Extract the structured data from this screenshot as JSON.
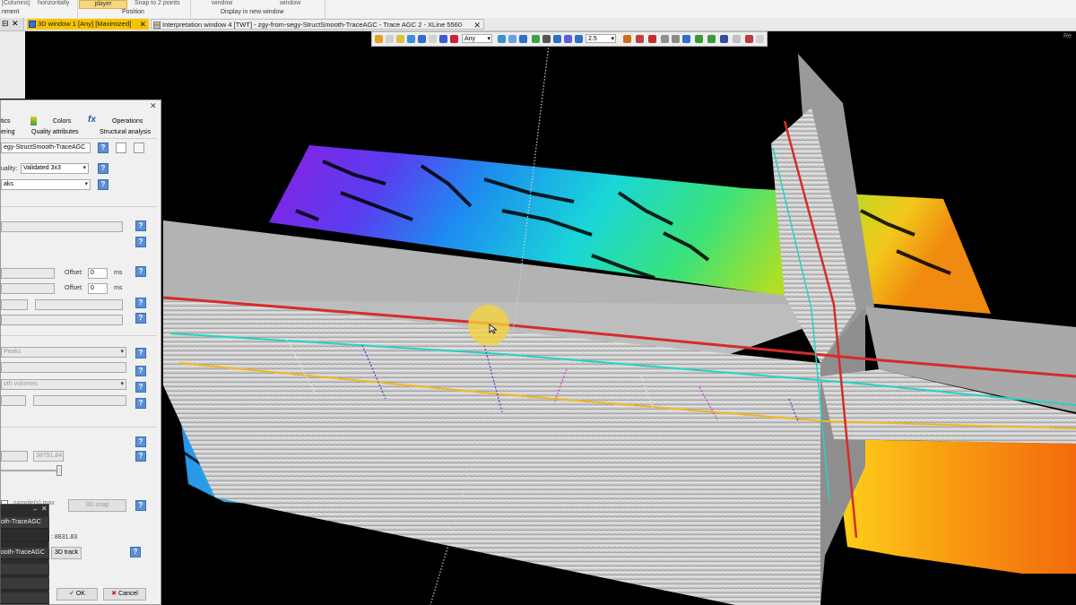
{
  "ribbon": {
    "items": [
      {
        "label": "[Columns]"
      },
      {
        "label": "horizontally"
      },
      {
        "label": "player",
        "active": true
      },
      {
        "label": "Snap to 2 points"
      },
      {
        "label": "window"
      },
      {
        "label": "window"
      }
    ],
    "groups": [
      "nment",
      "Position",
      "Display in new window"
    ]
  },
  "tabs": [
    {
      "label": "3D window 1 [Any] [Maximized]",
      "active": true
    },
    {
      "label": "Interpretation window 4 [TWT] - zgy-from-segy-StructSmooth-TraceAGC - Trace AGC 2 - XLine 5560",
      "active": false
    }
  ],
  "viewport_toolbar": {
    "domain_value": "Any",
    "zoom_value": "2.5"
  },
  "viewport": {
    "corner_label": "Re"
  },
  "dialog": {
    "tabs_row1": [
      "tics",
      "Colors",
      "Operations"
    ],
    "tabs_row2": [
      "ering",
      "Quality attributes",
      "Structural analysis"
    ],
    "input_name": "egy-StructSmooth-TraceAGC",
    "quality_label": "uality:",
    "quality_value": "Validated 3x3",
    "mode_value": "aks",
    "offset_label": "Offset:",
    "offset_value": "0",
    "offset_unit": "ms",
    "method_value": "Peaks",
    "volumes_value": "oth volumes",
    "number_value": "38791.84",
    "sample_label": "sample(s) max",
    "snap_button": "3D snap",
    "z_readout": ": 8831.83",
    "track_button": "3D track",
    "ok_button": "OK",
    "cancel_button": "Cancel"
  },
  "popup_list": {
    "items": [
      "oth-TraceAGC",
      "ooth-TraceAGC"
    ]
  }
}
